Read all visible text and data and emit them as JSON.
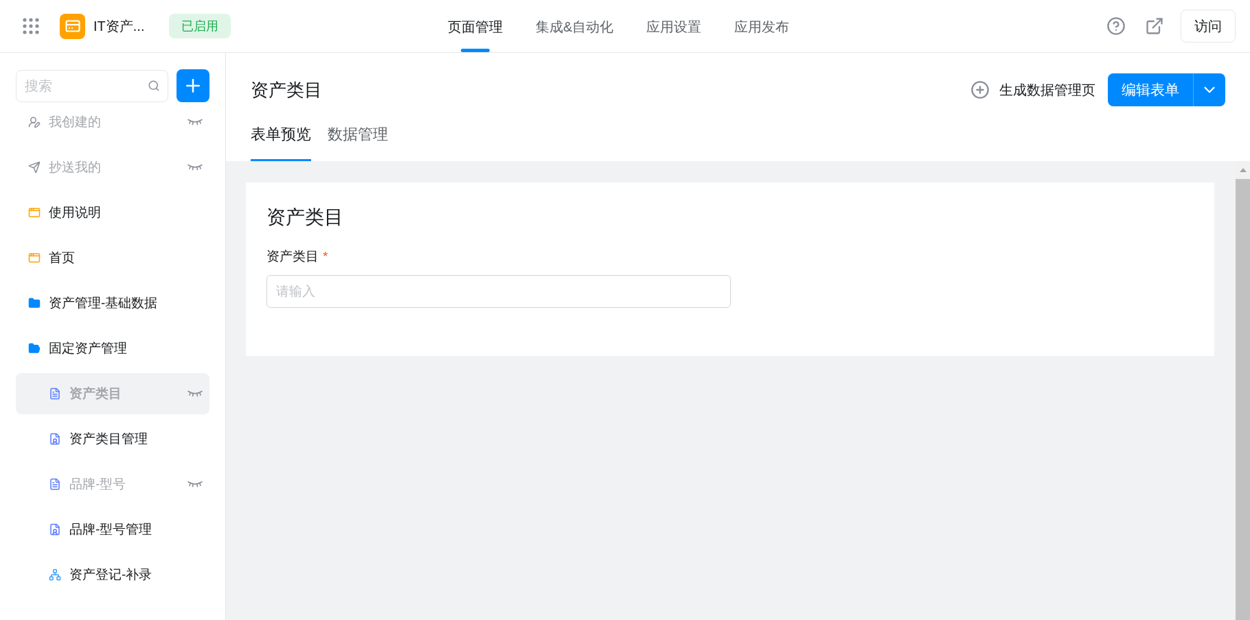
{
  "app": {
    "name": "IT资产...",
    "status": "已启用"
  },
  "nav": [
    {
      "label": "页面管理",
      "selected": true
    },
    {
      "label": "集成&自动化",
      "selected": false
    },
    {
      "label": "应用设置",
      "selected": false
    },
    {
      "label": "应用发布",
      "selected": false
    }
  ],
  "visit_button": "访问",
  "sidebar": {
    "search": {
      "placeholder": "搜索"
    },
    "items": [
      {
        "label": "我创建的",
        "kind": "mine",
        "hidden": true,
        "selected": false
      },
      {
        "label": "抄送我的",
        "kind": "sent",
        "hidden": true,
        "selected": false
      },
      {
        "label": "使用说明",
        "kind": "page",
        "hidden": false,
        "selected": false
      },
      {
        "label": "首页",
        "kind": "page",
        "hidden": false,
        "selected": false
      },
      {
        "label": "资产管理-基础数据",
        "kind": "folder",
        "hidden": false,
        "selected": false,
        "expanded": false
      },
      {
        "label": "固定资产管理",
        "kind": "folder",
        "hidden": false,
        "selected": false,
        "expanded": true,
        "children": [
          {
            "label": "资产类目",
            "kind": "form",
            "hidden": true,
            "selected": true
          },
          {
            "label": "资产类目管理",
            "kind": "report",
            "hidden": false,
            "selected": false
          },
          {
            "label": "品牌-型号",
            "kind": "form",
            "hidden": true,
            "selected": false
          },
          {
            "label": "品牌-型号管理",
            "kind": "report",
            "hidden": false,
            "selected": false
          },
          {
            "label": "资产登记-补录",
            "kind": "flow",
            "hidden": false,
            "selected": false
          }
        ]
      }
    ]
  },
  "page": {
    "title": "资产类目",
    "generate_link": "生成数据管理页",
    "edit_button": "编辑表单",
    "tabs": [
      {
        "label": "表单预览",
        "selected": true
      },
      {
        "label": "数据管理",
        "selected": false
      }
    ]
  },
  "form": {
    "title": "资产类目",
    "fields": [
      {
        "label": "资产类目",
        "required_mark": "*",
        "placeholder": "请输入"
      }
    ]
  }
}
